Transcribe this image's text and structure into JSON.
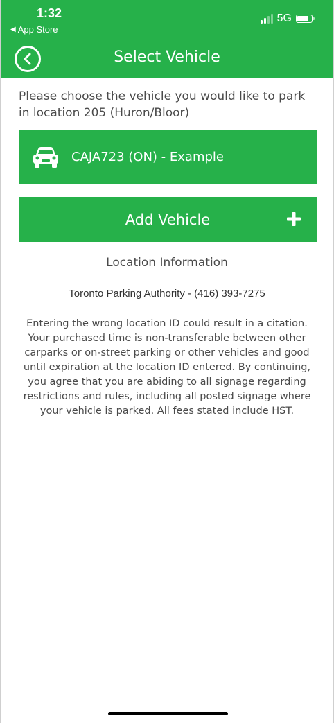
{
  "status_bar": {
    "time": "1:32",
    "back_app": "App Store",
    "network": "5G",
    "signal_bars_active": 2,
    "signal_bars_total": 4
  },
  "header": {
    "title": "Select Vehicle",
    "back_icon": "chevron-left-circle-icon"
  },
  "intro_text": "Please choose the vehicle you would like to park in location 205 (Huron/Bloor)",
  "vehicles": [
    {
      "label": "CAJA723 (ON) - Example",
      "icon": "car-icon"
    }
  ],
  "add_vehicle": {
    "label": "Add Vehicle",
    "icon": "plus-icon"
  },
  "location_info": {
    "heading": "Location Information",
    "authority": "Toronto Parking Authority - (416) 393-7275",
    "disclaimer": "Entering the wrong location ID could result in a citation. Your purchased time is non-transferable between other carparks or on-street parking or other vehicles and good until expiration at the location ID entered. By continuing, you agree that you are abiding to all signage regarding restrictions and rules, including all posted signage where your vehicle is parked. All fees stated include HST."
  },
  "colors": {
    "brand_green": "#26b14a",
    "text_gray": "#4a4a4a",
    "white": "#ffffff"
  }
}
